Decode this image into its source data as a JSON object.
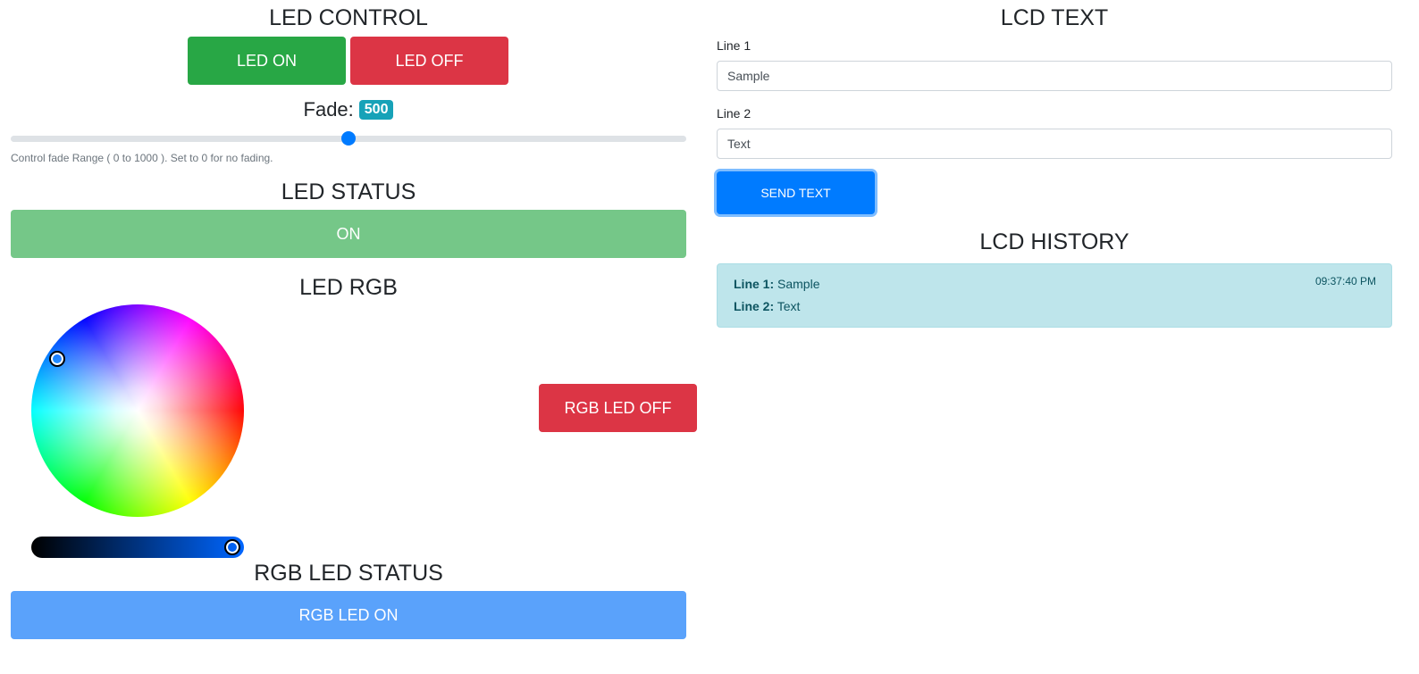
{
  "led_control": {
    "title": "LED CONTROL",
    "on_label": "LED ON",
    "off_label": "LED OFF",
    "fade_label": "Fade:",
    "fade_value": "500",
    "fade_min": 0,
    "fade_max": 1000,
    "fade_help": "Control fade Range ( 0 to 1000 ). Set to 0 for no fading."
  },
  "led_status": {
    "title": "LED STATUS",
    "value": "ON"
  },
  "led_rgb": {
    "title": "LED RGB",
    "off_button": "RGB LED OFF",
    "brightness_level": 1.0
  },
  "rgb_status": {
    "title": "RGB LED STATUS",
    "value": "RGB LED ON"
  },
  "lcd_text": {
    "title": "LCD TEXT",
    "line1_label": "Line 1",
    "line1_value": "Sample",
    "line2_label": "Line 2",
    "line2_value": "Text",
    "send_label": "SEND TEXT"
  },
  "lcd_history": {
    "title": "LCD HISTORY",
    "entries": [
      {
        "line1_label": "Line 1:",
        "line1": "Sample",
        "line2_label": "Line 2:",
        "line2": "Text",
        "time": "09:37:40 PM"
      }
    ]
  },
  "colors": {
    "success": "#28a745",
    "danger": "#dc3545",
    "primary": "#007bff",
    "info": "#17a2b8",
    "status_on": "#75c788",
    "rgb_status": "#5aa2fb"
  }
}
